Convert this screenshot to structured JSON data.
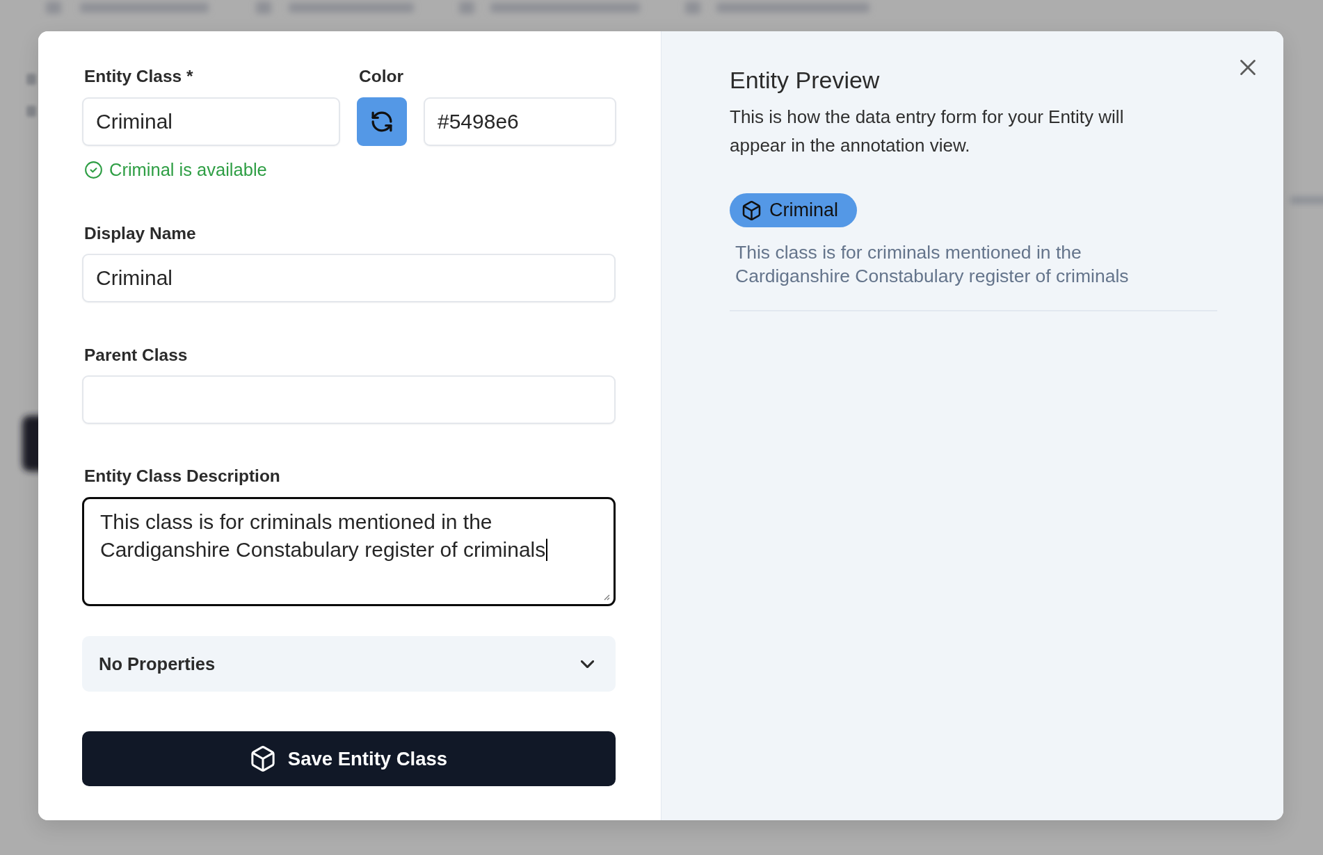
{
  "form": {
    "entity_class": {
      "label": "Entity Class *",
      "value": "Criminal",
      "status": "Criminal is available"
    },
    "color_field": {
      "label": "Color",
      "value": "#5498e6",
      "color": "#5498e6"
    },
    "display_name": {
      "label": "Display Name",
      "value": "Criminal"
    },
    "parent_class": {
      "label": "Parent Class"
    },
    "description": {
      "label": "Entity Class Description",
      "value": "This class is for criminals mentioned in the Cardiganshire Constabulary register of criminals",
      "focused": true
    },
    "properties": {
      "label": "No Properties",
      "expanded": false
    },
    "save_button": {
      "label": "Save Entity Class"
    }
  },
  "preview": {
    "title": "Entity Preview",
    "intro": "This is how the data entry form for your Entity will appear in the annotation view.",
    "badge": {
      "label": "Criminal"
    },
    "description": "This class is for criminals mentioned in the Cardiganshire Constabulary register of criminals"
  }
}
